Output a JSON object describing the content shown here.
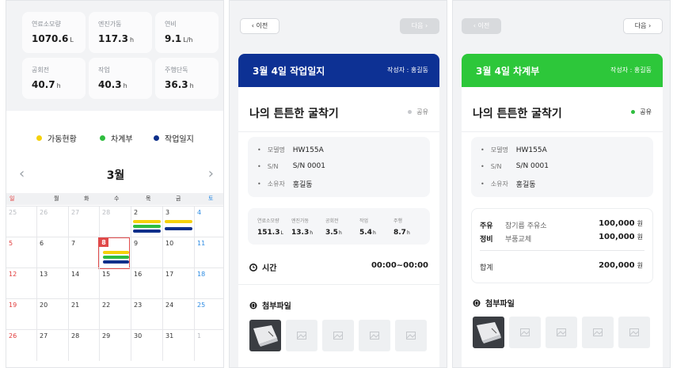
{
  "colors": {
    "operation": "#f5d10b",
    "ledger": "#2fbd3f",
    "worklog": "#0d2f8a",
    "worklog_header": "#0d3194",
    "ledger_header": "#2dc73a",
    "today": "#e04a4a"
  },
  "dashboard": {
    "stats": [
      {
        "label": "연료소모량",
        "value": "1070.6",
        "unit": "L"
      },
      {
        "label": "엔진가동",
        "value": "117.3",
        "unit": "h"
      },
      {
        "label": "연비",
        "value": "9.1",
        "unit": "L/h"
      },
      {
        "label": "공회전",
        "value": "40.7",
        "unit": "h"
      },
      {
        "label": "작업",
        "value": "40.3",
        "unit": "h"
      },
      {
        "label": "주행단독",
        "value": "36.3",
        "unit": "h"
      }
    ],
    "legend": [
      {
        "label": "가동현황",
        "icon": "yellow-dot"
      },
      {
        "label": "차계부",
        "icon": "green-dot"
      },
      {
        "label": "작업일지",
        "icon": "navy-dot"
      }
    ],
    "month": "3월",
    "weekdays": [
      "일",
      "월",
      "화",
      "수",
      "목",
      "금",
      "토"
    ],
    "weeks": [
      [
        "25",
        "26",
        "27",
        "28",
        "2",
        "3",
        "4"
      ],
      [
        "5",
        "6",
        "7",
        "8",
        "9",
        "10",
        "11"
      ],
      [
        "12",
        "13",
        "14",
        "15",
        "16",
        "17",
        "18"
      ],
      [
        "19",
        "20",
        "21",
        "22",
        "23",
        "24",
        "25"
      ],
      [
        "26",
        "27",
        "28",
        "29",
        "30",
        "31",
        "1"
      ]
    ]
  },
  "worklog": {
    "prev_label": "이전",
    "next_label": "다음",
    "title": "3월 4일 작업일지",
    "writer": "작성자 : 홍길동",
    "equipment_name": "나의 튼튼한 굴착기",
    "share_label": "공유",
    "info": [
      {
        "key": "모델명",
        "value": "HW155A"
      },
      {
        "key": "S/N",
        "value": "S/N 0001"
      },
      {
        "key": "소유자",
        "value": "홍길동"
      }
    ],
    "mini_stats": [
      {
        "label": "연료소모량",
        "value": "151.3",
        "unit": "L"
      },
      {
        "label": "엔진가동",
        "value": "13.3",
        "unit": "h"
      },
      {
        "label": "공회전",
        "value": "3.5",
        "unit": "h"
      },
      {
        "label": "작업",
        "value": "5.4",
        "unit": "h"
      },
      {
        "label": "주행",
        "value": "8.7",
        "unit": "h"
      }
    ],
    "time_label": "시간",
    "time_value": "00:00~00:00",
    "attach_label": "첨부파일"
  },
  "ledger": {
    "prev_label": "이전",
    "next_label": "다음",
    "title": "3월 4일 차계부",
    "writer": "작성자 : 홍길동",
    "equipment_name": "나의 튼튼한 굴착기",
    "share_label": "공유",
    "info": [
      {
        "key": "모델명",
        "value": "HW155A"
      },
      {
        "key": "S/N",
        "value": "S/N 0001"
      },
      {
        "key": "소유자",
        "value": "홍길동"
      }
    ],
    "costs": [
      {
        "key": "주유",
        "desc": "참기름 주유소",
        "value": "100,000",
        "unit": "원"
      },
      {
        "key": "정비",
        "desc": "부품교체",
        "value": "100,000",
        "unit": "원"
      }
    ],
    "total_label": "합계",
    "total_value": "200,000",
    "total_unit": "원",
    "attach_label": "첨부파일"
  }
}
